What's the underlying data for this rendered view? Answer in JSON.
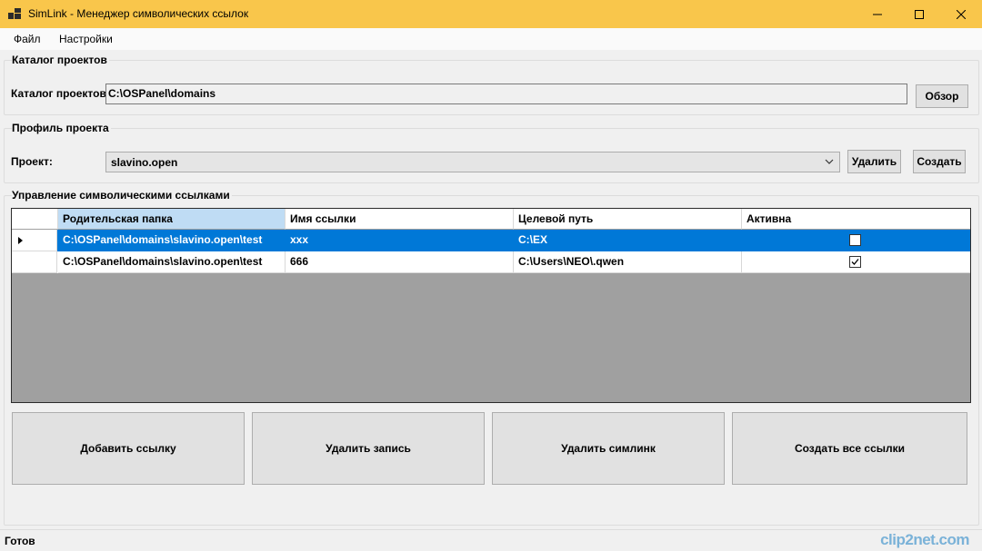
{
  "window": {
    "title": "SimLink - Менеджер символических ссылок",
    "accent_color": "#f9c64b"
  },
  "menu": {
    "items": [
      {
        "label": "Файл"
      },
      {
        "label": "Настройки"
      }
    ]
  },
  "catalog_group": {
    "title": "Каталог проектов",
    "label": "Каталог проектов:",
    "value": "C:\\OSPanel\\domains",
    "browse_label": "Обзор"
  },
  "profile_group": {
    "title": "Профиль проекта",
    "label": "Проект:",
    "selected": "slavino.open",
    "delete_label": "Удалить",
    "create_label": "Создать"
  },
  "links_group": {
    "title": "Управление символическими ссылками",
    "columns": [
      "Родительская папка",
      "Имя ссылки",
      "Целевой путь",
      "Активна"
    ],
    "rows": [
      {
        "parent": "C:\\OSPanel\\domains\\slavino.open\\test",
        "name": "xxx",
        "target": "C:\\EX",
        "active": false,
        "selected": true
      },
      {
        "parent": "C:\\OSPanel\\domains\\slavino.open\\test",
        "name": "666",
        "target": "C:\\Users\\NEO\\.qwen",
        "active": true,
        "selected": false
      }
    ]
  },
  "actions": {
    "add_link": "Добавить ссылку",
    "delete_record": "Удалить запись",
    "delete_symlink": "Удалить симлинк",
    "create_all": "Создать все ссылки"
  },
  "status": {
    "text": "Готов"
  },
  "watermark": "clip2net.com"
}
